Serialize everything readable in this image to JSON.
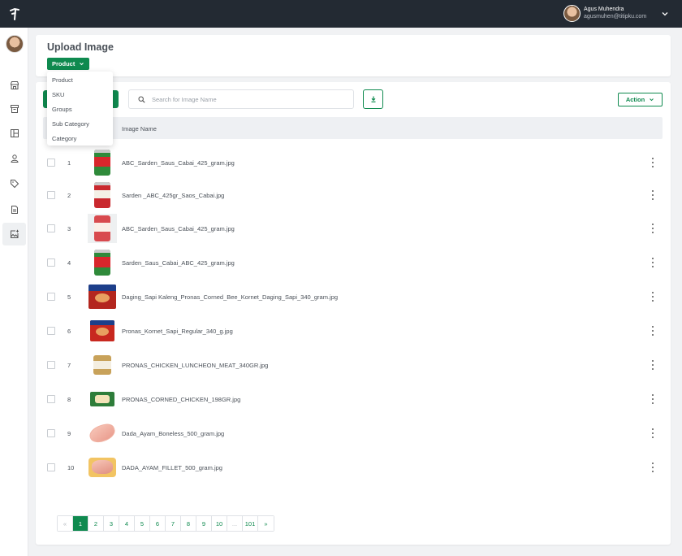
{
  "user": {
    "name": "Agus Muhendra",
    "email": "agusmuhen@titipku.com"
  },
  "sidebar": {
    "items": [
      {
        "icon": "store-icon"
      },
      {
        "icon": "archive-icon"
      },
      {
        "icon": "layout-icon"
      },
      {
        "icon": "user-icon"
      },
      {
        "icon": "tag-icon"
      },
      {
        "icon": "document-icon"
      },
      {
        "icon": "image-add-icon",
        "active": true
      }
    ]
  },
  "header": {
    "title": "Upload Image",
    "dropdown_label": "Product"
  },
  "dropdown": {
    "items": [
      "Product",
      "SKU",
      "Groups",
      "Sub Category",
      "Category"
    ]
  },
  "toolbar": {
    "search_placeholder": "Search for Image Name",
    "action_label": "Action"
  },
  "table": {
    "column_header": "Image Name",
    "rows": [
      {
        "num": "1",
        "name": "ABC_Sarden_Saus_Cabai_425_gram.jpg",
        "thumb": "can-green"
      },
      {
        "num": "2",
        "name": "Sarden _ABC_425gr_Saos_Cabai.jpg",
        "thumb": "can-red"
      },
      {
        "num": "3",
        "name": "ABC_Sarden_Saus_Cabai_425_gram.jpg",
        "thumb": "can-red-light"
      },
      {
        "num": "4",
        "name": "Sarden_Saus_Cabai_ABC_425_gram.jpg",
        "thumb": "can-green"
      },
      {
        "num": "5",
        "name": "Daging_Sapi Kaleng_Pronas_Corned_Bee_Kornet_Daging_Sapi_340_gram.jpg",
        "thumb": "box-pronas"
      },
      {
        "num": "6",
        "name": "Pronas_Kornet_Sapi_Regular_340_g.jpg",
        "thumb": "box-pronas-red"
      },
      {
        "num": "7",
        "name": "PRONAS_CHICKEN_LUNCHEON_MEAT_340GR.jpg",
        "thumb": "can-gold"
      },
      {
        "num": "8",
        "name": "PRONAS_CORNED_CHICKEN_198GR.jpg",
        "thumb": "box-green"
      },
      {
        "num": "9",
        "name": "Dada_Ayam_Boneless_500_gram.jpg",
        "thumb": "meat"
      },
      {
        "num": "10",
        "name": "DADA_AYAM_FILLET_500_gram.jpg",
        "thumb": "tray"
      }
    ]
  },
  "pagination": {
    "prev": "«",
    "pages": [
      "1",
      "2",
      "3",
      "4",
      "5",
      "6",
      "7",
      "8",
      "9",
      "10"
    ],
    "ellipsis": "...",
    "last": "101",
    "next": "»",
    "current": "1"
  },
  "colors": {
    "accent": "#0f8a4f",
    "topbar": "#232a33"
  }
}
